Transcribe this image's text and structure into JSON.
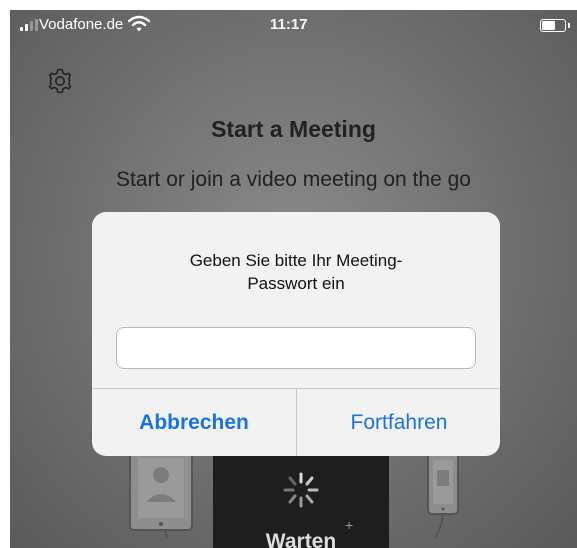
{
  "status_bar": {
    "carrier": "Vodafone.de",
    "time": "11:17"
  },
  "page": {
    "title": "Start a Meeting",
    "subtitle": "Start or join a video meeting on the go"
  },
  "dialog": {
    "message_line1": "Geben Sie bitte Ihr Meeting-",
    "message_line2": "Passwort ein",
    "password_value": "",
    "cancel_label": "Abbrechen",
    "continue_label": "Fortfahren"
  },
  "illustration": {
    "status_text": "Warten"
  },
  "icons": {
    "settings": "gear-icon",
    "wifi": "wifi-icon",
    "battery": "battery-icon",
    "signal": "signal-icon",
    "spinner": "spinner-icon"
  },
  "colors": {
    "accent": "#1a73d9",
    "dialog_bg": "#f2f2f2",
    "panel_dark": "#1e1e1e"
  }
}
